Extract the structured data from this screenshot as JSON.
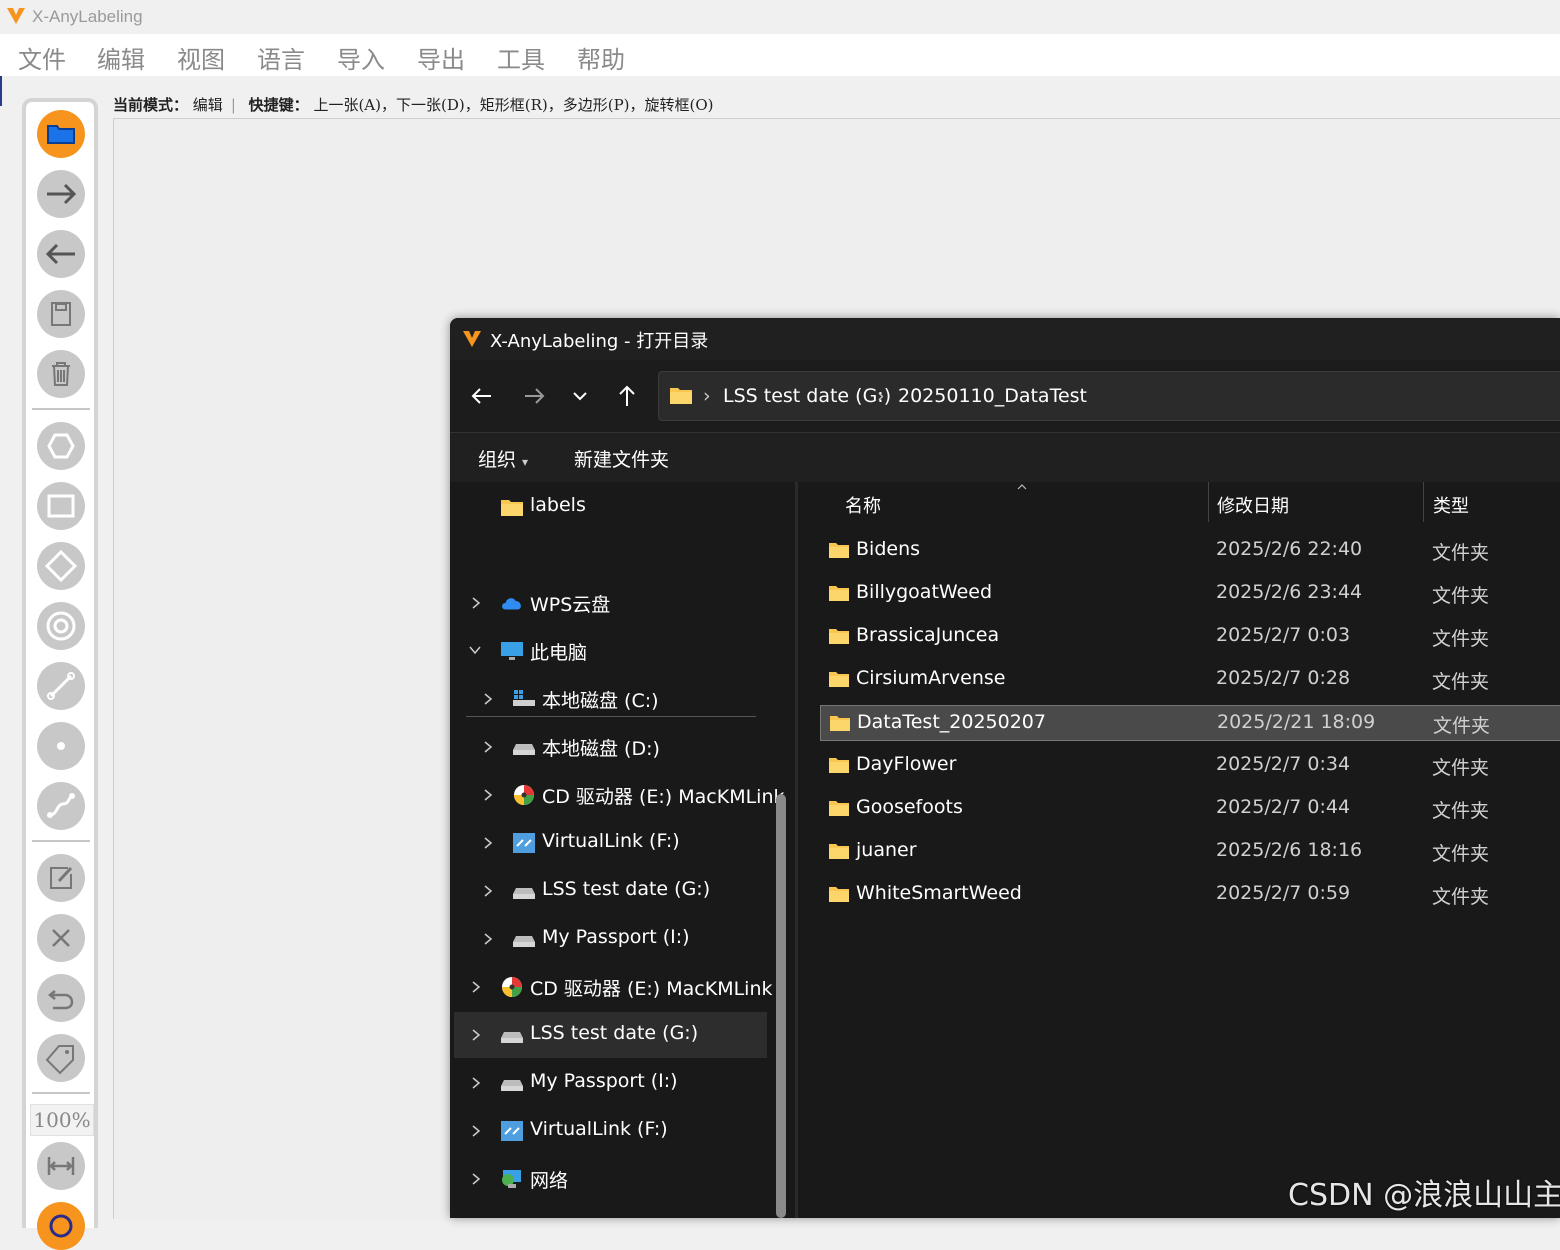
{
  "app": {
    "title": "X-AnyLabeling",
    "brand_color": "#f7941d"
  },
  "menu": [
    "文件",
    "编辑",
    "视图",
    "语言",
    "导入",
    "导出",
    "工具",
    "帮助"
  ],
  "modebar": {
    "mode_label": "当前模式：",
    "mode_value": "编辑",
    "shortcut_label": "快捷键：",
    "shortcuts": "上一张(A)，下一张(D)，矩形框(R)，多边形(P)，旋转框(O)"
  },
  "toolbar": {
    "zoom": "100%",
    "tools": [
      "open-dir-icon",
      "next-image-icon",
      "prev-image-icon",
      "save-icon",
      "delete-icon",
      "polygon-icon",
      "rectangle-icon",
      "rotation-icon",
      "circle-icon",
      "line-icon",
      "point-icon",
      "linestrip-icon",
      "edit-icon",
      "close-icon",
      "undo-icon",
      "label-icon",
      "fit-width-icon",
      "auto-label-icon"
    ]
  },
  "dialog": {
    "title": "X-AnyLabeling - 打开目录",
    "address": {
      "drive": "LSS test date (G:)",
      "folder": "20250110_DataTest"
    },
    "commands": {
      "organize": "组织",
      "new_folder": "新建文件夹"
    },
    "nav": {
      "top_folder": "labels",
      "items": [
        {
          "label": "WPS云盘",
          "icon": "cloud-icon"
        },
        {
          "label": "此电脑",
          "icon": "computer-icon"
        },
        {
          "label": "本地磁盘 (C:)",
          "icon": "windows-drive-icon"
        },
        {
          "label": "本地磁盘 (D:)",
          "icon": "drive-icon"
        },
        {
          "label": "CD 驱动器 (E:) MacKMLink",
          "icon": "cd-drive-icon"
        },
        {
          "label": "VirtualLink (F:)",
          "icon": "network-drive-icon"
        },
        {
          "label": "LSS test date (G:)",
          "icon": "drive-icon"
        },
        {
          "label": "My Passport (I:)",
          "icon": "drive-icon"
        },
        {
          "label": "CD 驱动器 (E:) MacKMLink",
          "icon": "cd-drive-icon"
        },
        {
          "label": "LSS test date (G:)",
          "icon": "drive-icon"
        },
        {
          "label": "My Passport (I:)",
          "icon": "drive-icon"
        },
        {
          "label": "VirtualLink (F:)",
          "icon": "network-drive-icon"
        },
        {
          "label": "网络",
          "icon": "network-icon"
        }
      ]
    },
    "columns": {
      "name": "名称",
      "modified": "修改日期",
      "type": "类型"
    },
    "files": [
      {
        "name": "Bidens",
        "date": "2025/2/6 22:40",
        "type": "文件夹"
      },
      {
        "name": "BillygoatWeed",
        "date": "2025/2/6 23:44",
        "type": "文件夹"
      },
      {
        "name": "BrassicaJuncea",
        "date": "2025/2/7 0:03",
        "type": "文件夹"
      },
      {
        "name": "CirsiumArvense",
        "date": "2025/2/7 0:28",
        "type": "文件夹"
      },
      {
        "name": "DataTest_20250207",
        "date": "2025/2/21 18:09",
        "type": "文件夹"
      },
      {
        "name": "DayFlower",
        "date": "2025/2/7 0:34",
        "type": "文件夹"
      },
      {
        "name": "Goosefoots",
        "date": "2025/2/7 0:44",
        "type": "文件夹"
      },
      {
        "name": "juaner",
        "date": "2025/2/6 18:16",
        "type": "文件夹"
      },
      {
        "name": "WhiteSmartWeed",
        "date": "2025/2/7 0:59",
        "type": "文件夹"
      }
    ]
  },
  "watermark": "CSDN @浪浪山山主"
}
